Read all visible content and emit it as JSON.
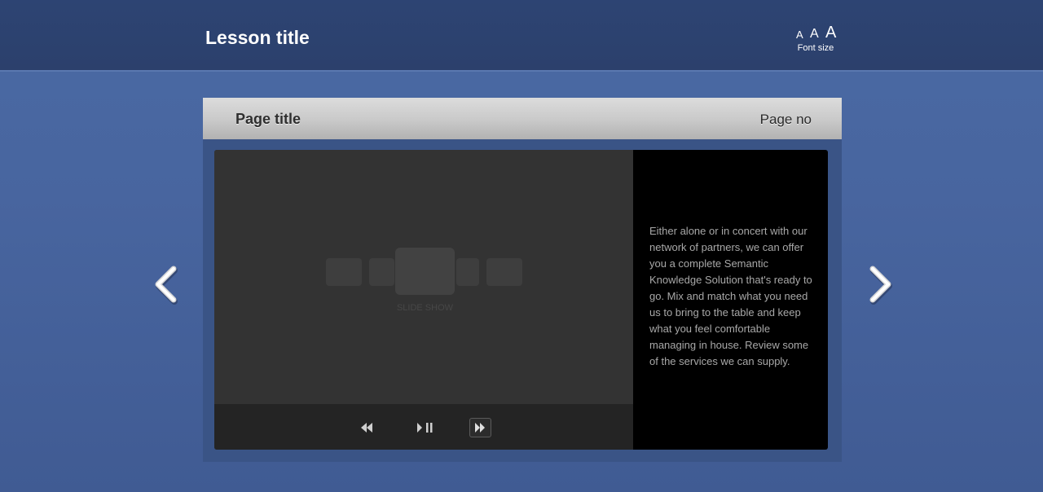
{
  "header": {
    "lesson_title": "Lesson title",
    "font_size": {
      "small_label": "A",
      "medium_label": "A",
      "large_label": "A",
      "caption": "Font size"
    }
  },
  "page": {
    "title": "Page title",
    "page_no": "Page no"
  },
  "slideshow": {
    "label": "SLIDE SHOW",
    "controls": [
      "rewind",
      "play-pause",
      "fast-forward"
    ]
  },
  "description": {
    "text": "Either alone or in concert with our network of partners, we can offer you a complete Semantic Knowledge Solution that's ready to go. Mix and match what you need us to bring to the table and keep what you feel comfortable managing in house. Review some of the services we can supply."
  },
  "navigation": {
    "prev_icon": "chevron-left-icon",
    "next_icon": "chevron-right-icon"
  },
  "colors": {
    "background": "#48659f",
    "header": "#2c406c",
    "panel": "#3a5486",
    "slideshow": "#333333",
    "controls": "#242424",
    "description_bg": "#000000",
    "description_text": "#a8a8a8"
  }
}
